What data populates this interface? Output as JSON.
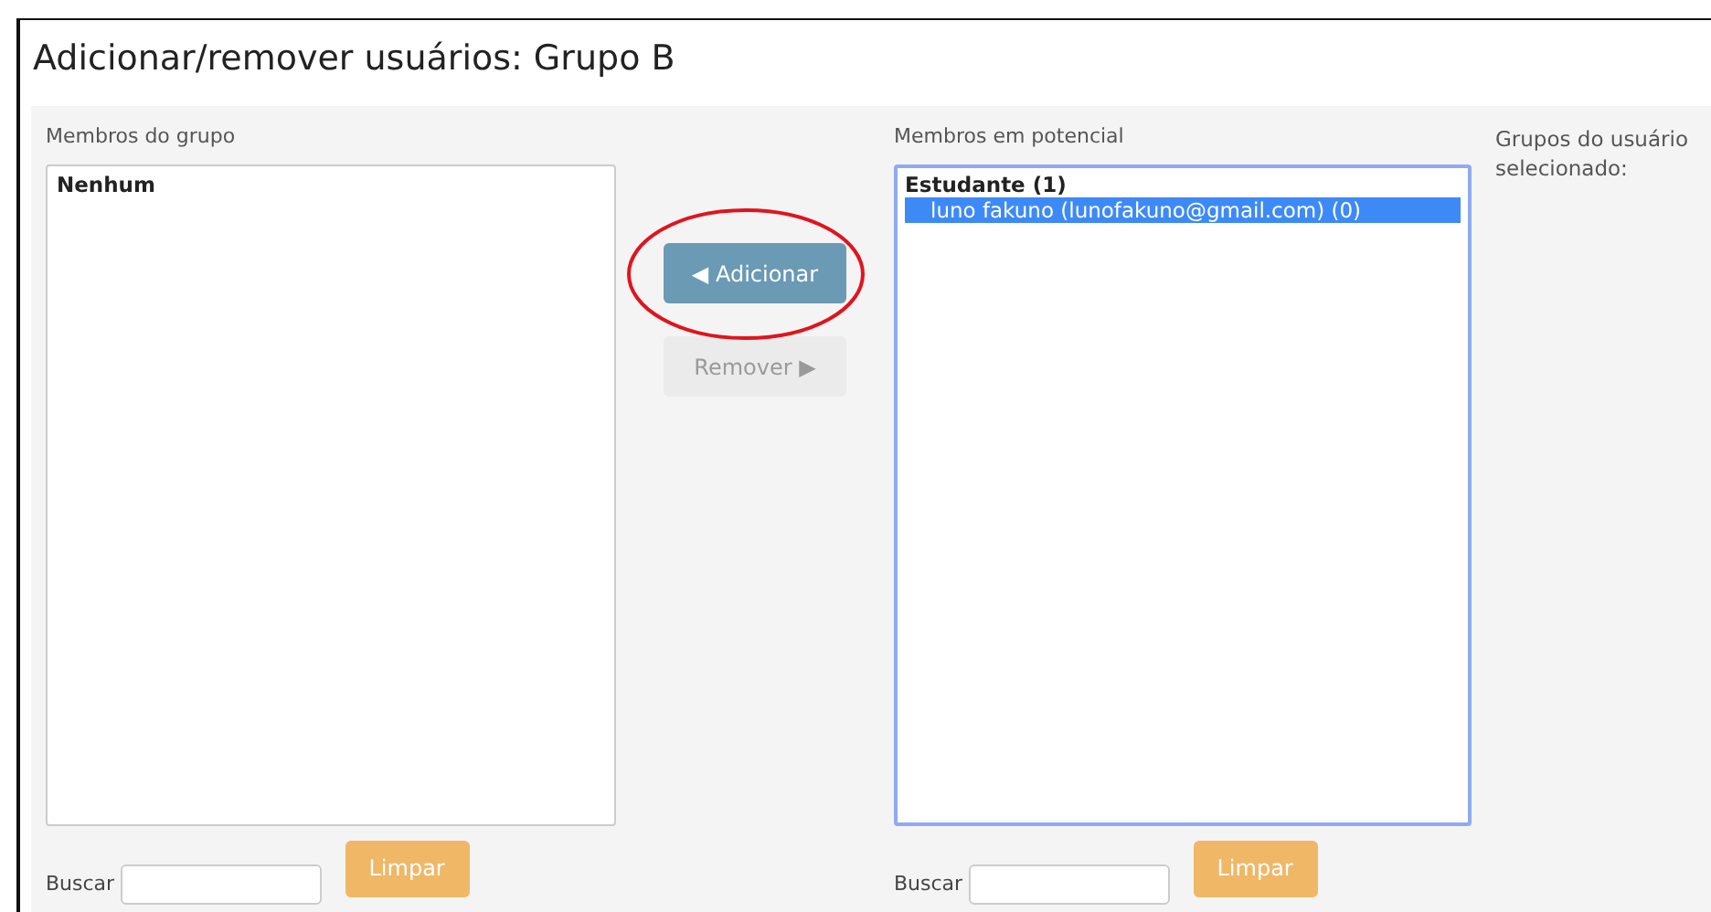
{
  "title": "Adicionar/remover usuários: Grupo B",
  "members": {
    "label": "Membros do grupo",
    "items": [
      {
        "text": "Nenhum",
        "kind": "heading",
        "selected": false
      }
    ],
    "search_label": "Buscar",
    "clear_button": "Limpar"
  },
  "actions": [
    {
      "label": "◀ Adicionar",
      "disabled": false,
      "annotated": true
    },
    {
      "label": "Remover ▶",
      "disabled": true,
      "annotated": false
    }
  ],
  "potential": {
    "label": "Membros em potencial",
    "items": [
      {
        "text": "Estudante (1)",
        "kind": "heading",
        "selected": false
      },
      {
        "text": "luno fakuno (lunofakuno@gmail.com) (0)",
        "kind": "option",
        "selected": true
      }
    ],
    "focused": true,
    "search_label": "Buscar",
    "clear_button": "Limpar"
  },
  "user_groups": {
    "label": "Grupos do usuário selecionado:"
  }
}
